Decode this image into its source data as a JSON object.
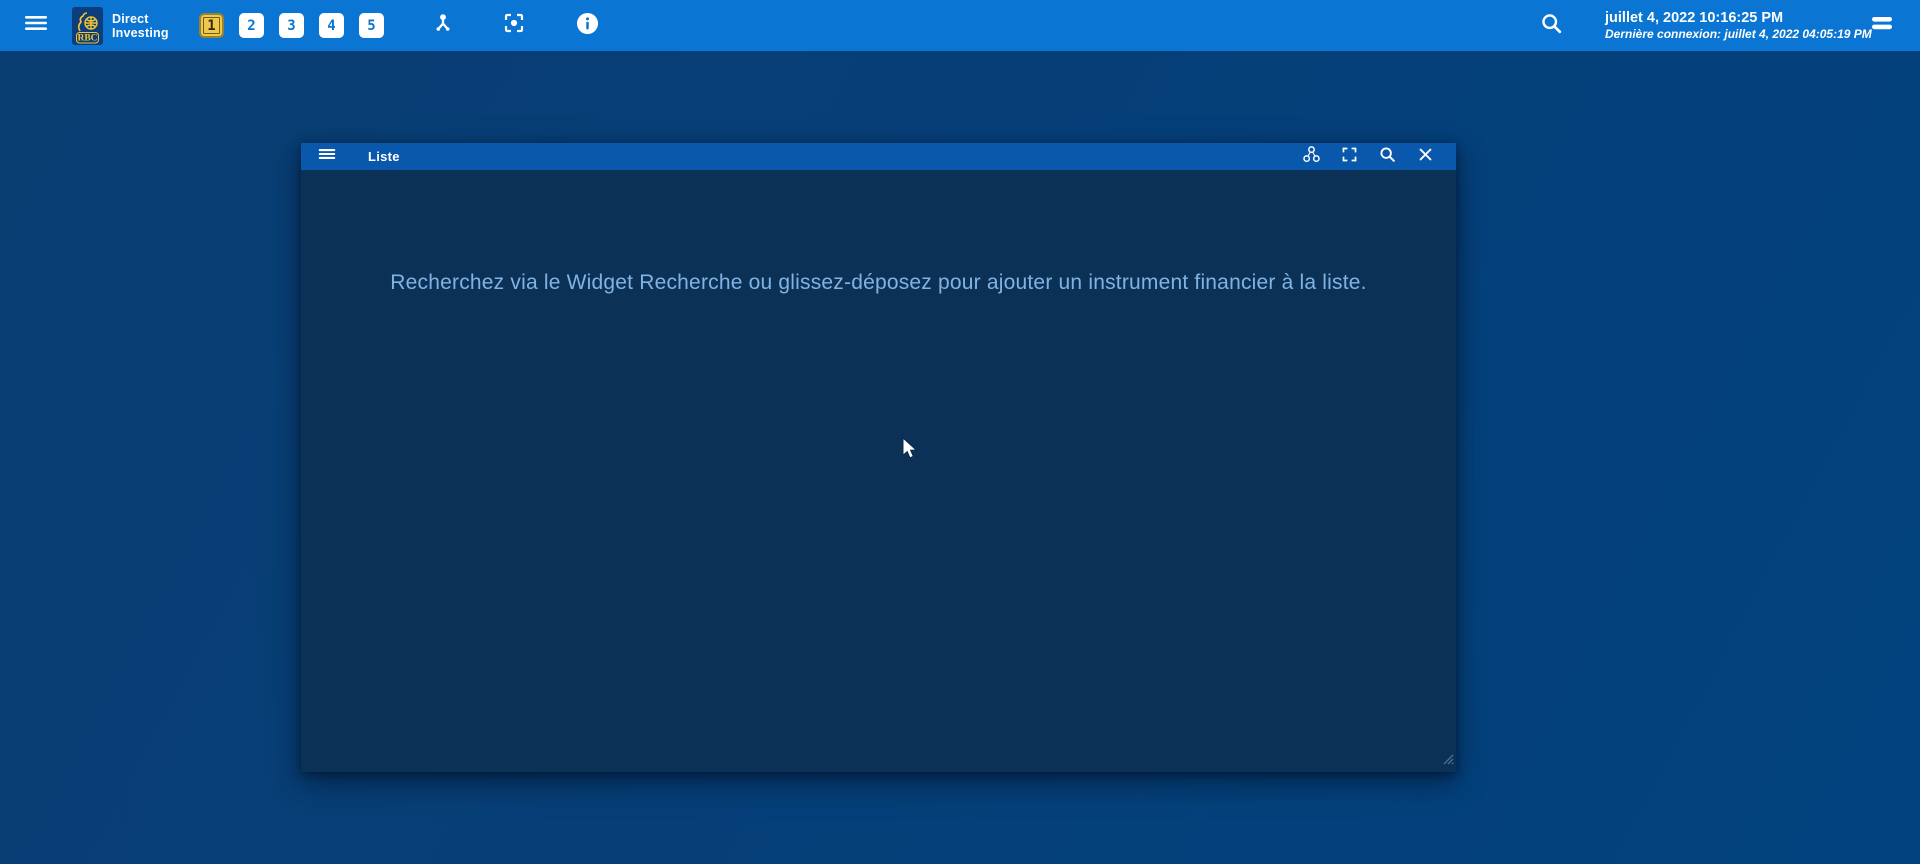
{
  "topbar": {
    "brand": {
      "logo_text": "RBC",
      "line1": "Direct",
      "line2": "Investing"
    },
    "tabs": [
      {
        "label": "1",
        "active": true
      },
      {
        "label": "2",
        "active": false
      },
      {
        "label": "3",
        "active": false
      },
      {
        "label": "4",
        "active": false
      },
      {
        "label": "5",
        "active": false
      }
    ],
    "clock": {
      "current_datetime": "juillet 4, 2022 10:16:25 PM",
      "last_login": "Dernière connexion: juillet 4, 2022 04:05:19 PM"
    }
  },
  "widget": {
    "title": "Liste",
    "empty_message": "Recherchez via le Widget Recherche ou glissez-déposez pour ajouter un instrument financier à la liste."
  },
  "icons": {
    "app-menu-icon": "hamburger ≡",
    "workspace-link-icon": "device-hub ⑂",
    "center-focus-icon": "frame with dot ⛶",
    "info-icon": "ⓘ",
    "search-icon": "magnifier ⌕",
    "panel-menu-icon": "two bars =",
    "widget-menu-icon": "hamburger ≡",
    "link-group-icon": "three linked circles ∴",
    "fullscreen-icon": "corner brackets ⛶",
    "close-icon": "✕",
    "resize-grip-icon": "diagonal lines ⋰",
    "mouse-cursor": "arrow pointer"
  },
  "colors": {
    "topbar": "#0a75d2",
    "widget_header": "#0a58ac",
    "widget_body": "#0c3156",
    "page_gradient_start": "#093e72",
    "page_gradient_end": "#02427e",
    "active_tab_yellow": "#f0c94a",
    "tab_number_blue": "#0b76d1",
    "message_text": "#80b3e4",
    "rbc_navy": "#0d3d7a",
    "rbc_gold": "#f4c431"
  }
}
